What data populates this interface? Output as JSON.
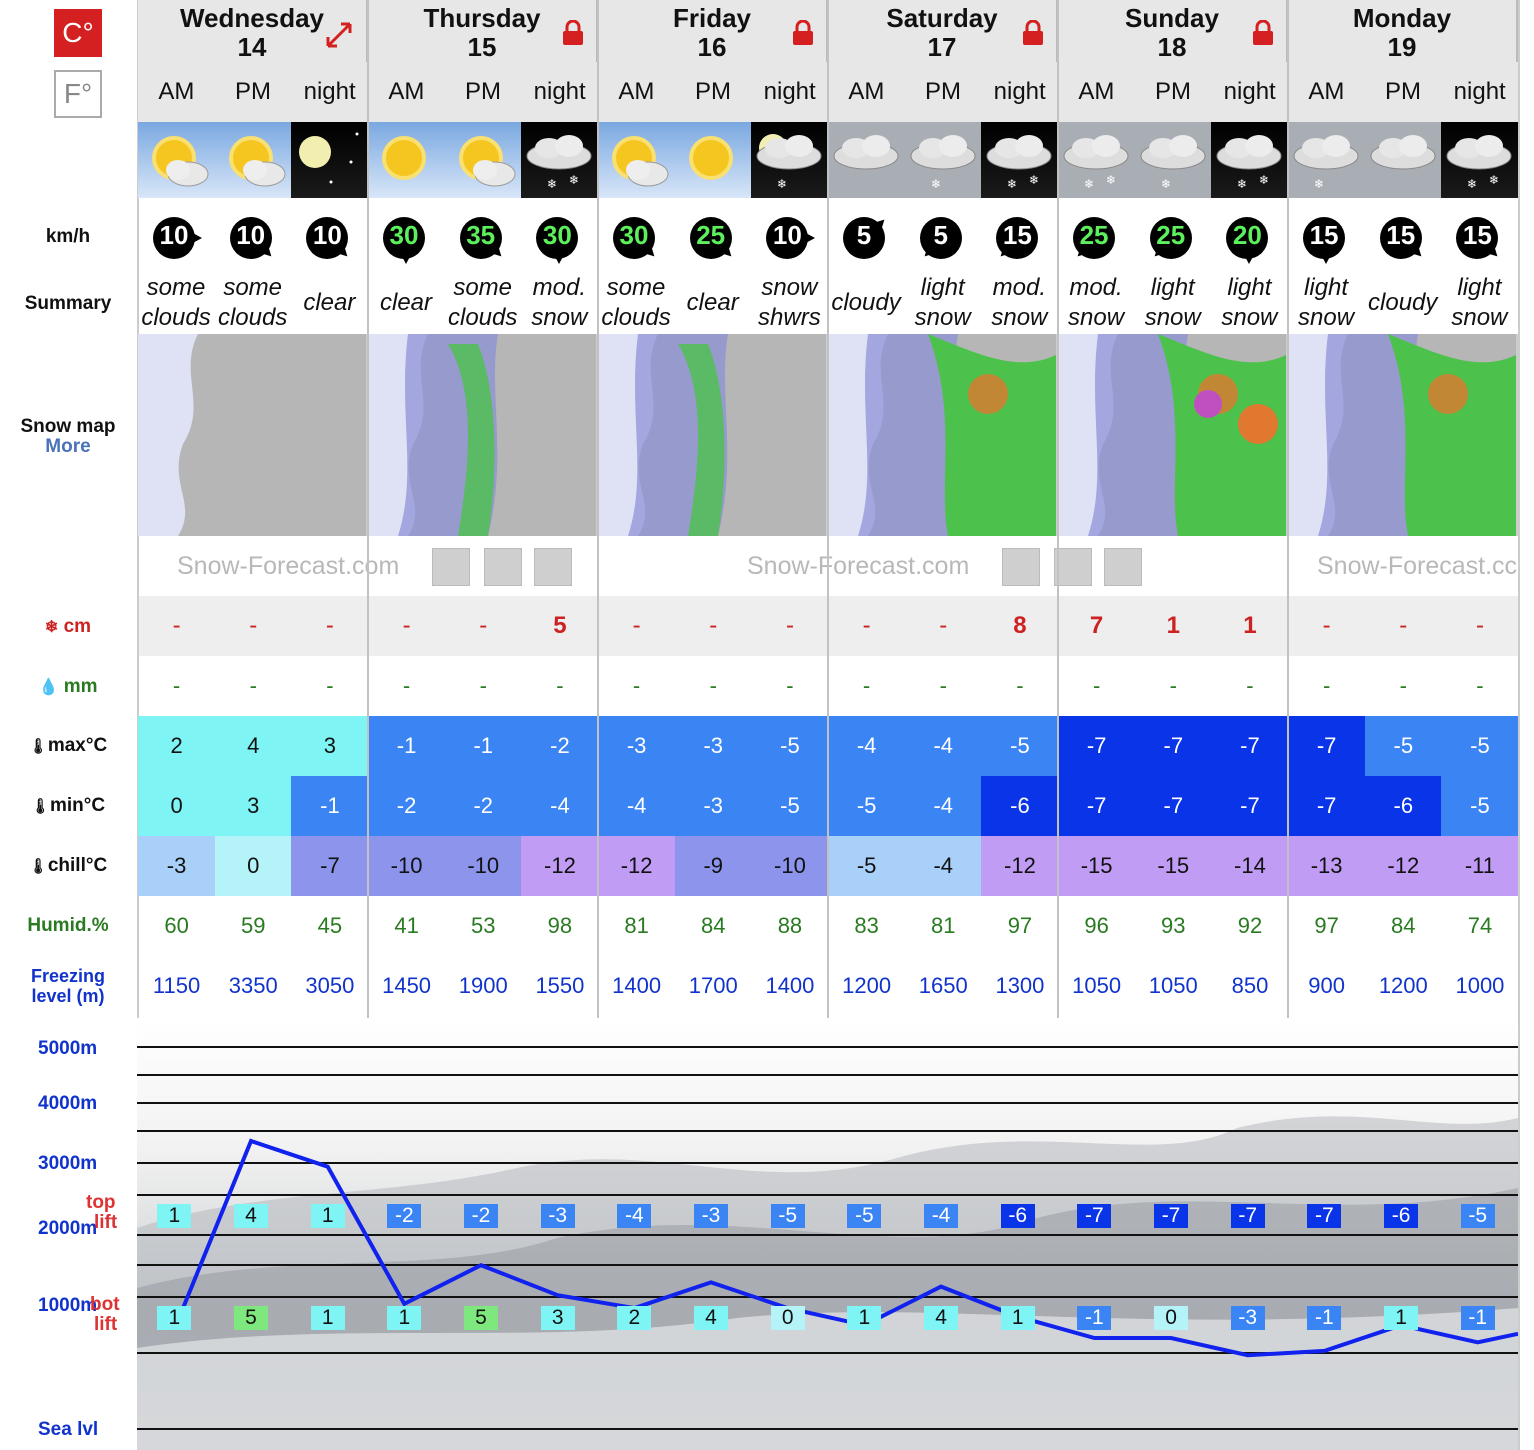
{
  "units": {
    "celsius": "C°",
    "fahrenheit": "F°",
    "active": "C"
  },
  "days": [
    {
      "name": "Wednesday",
      "date": "14",
      "icon": "expand-icon"
    },
    {
      "name": "Thursday",
      "date": "15",
      "icon": "lock-icon"
    },
    {
      "name": "Friday",
      "date": "16",
      "icon": "lock-icon"
    },
    {
      "name": "Saturday",
      "date": "17",
      "icon": "lock-icon"
    },
    {
      "name": "Sunday",
      "date": "18",
      "icon": "lock-icon"
    },
    {
      "name": "Monday",
      "date": "19",
      "icon": "none"
    }
  ],
  "labels": {
    "wind": "km/h",
    "summary": "Summary",
    "snow_map": "Snow map",
    "more": "More",
    "snow": "cm",
    "rain": "mm",
    "max": "max°C",
    "min": "min°C",
    "chill": "chill°C",
    "humid": "Humid.%",
    "freezing_1": "Freezing",
    "freezing_2": "level (m)",
    "alt_5000": "5000m",
    "alt_4000": "4000m",
    "alt_3000": "3000m",
    "alt_2000": "2000m",
    "alt_1000": "1000m",
    "sea": "Sea lvl",
    "top": "top",
    "lift": "lift",
    "bot": "bot",
    "watermark": "Snow-Forecast.com",
    "watermark_cut": "Snow-Forecast.cc"
  },
  "periods": [
    {
      "label": "AM",
      "weather": "some-clouds-day",
      "wind": "10",
      "wind_dir": 0,
      "wind_color": "white",
      "summary": [
        "some",
        "clouds"
      ],
      "snow": "-",
      "rain": "-",
      "max": "2",
      "max_bg": "#7ef4f4",
      "min": "0",
      "min_bg": "#7ef4f4",
      "chill": "-3",
      "chill_bg": "#a8d0f8",
      "humid": "60",
      "freezing": "1150",
      "top": "1",
      "top_bg": "#7ef4f4",
      "bot": "1",
      "bot_bg": "#7ef4f4"
    },
    {
      "label": "PM",
      "weather": "some-clouds-day",
      "wind": "10",
      "wind_dir": 45,
      "wind_color": "white",
      "summary": [
        "some",
        "clouds"
      ],
      "snow": "-",
      "rain": "-",
      "max": "4",
      "max_bg": "#7ef4f4",
      "min": "3",
      "min_bg": "#7ef4f4",
      "chill": "0",
      "chill_bg": "#b4f4f8",
      "humid": "59",
      "freezing": "3350",
      "top": "4",
      "top_bg": "#7ef4f4",
      "bot": "5",
      "bot_bg": "#7ee87e"
    },
    {
      "label": "night",
      "weather": "clear-night",
      "wind": "10",
      "wind_dir": 45,
      "wind_color": "white",
      "summary": [
        "clear"
      ],
      "snow": "-",
      "rain": "-",
      "max": "3",
      "max_bg": "#7ef4f4",
      "min": "-1",
      "min_bg": "#3b84f4",
      "chill": "-7",
      "chill_bg": "#8c94ec",
      "humid": "45",
      "freezing": "3050",
      "top": "1",
      "top_bg": "#7ef4f4",
      "bot": "1",
      "bot_bg": "#7ef4f4"
    },
    {
      "label": "AM",
      "weather": "clear-day",
      "wind": "30",
      "wind_dir": 90,
      "wind_color": "green",
      "summary": [
        "clear"
      ],
      "snow": "-",
      "rain": "-",
      "max": "-1",
      "max_bg": "#3b84f4",
      "min": "-2",
      "min_bg": "#3b84f4",
      "chill": "-10",
      "chill_bg": "#8c94ec",
      "humid": "41",
      "freezing": "1450",
      "top": "-2",
      "top_bg": "#3b84f4",
      "bot": "1",
      "bot_bg": "#7ef4f4"
    },
    {
      "label": "PM",
      "weather": "some-clouds-day",
      "wind": "35",
      "wind_dir": 45,
      "wind_color": "green",
      "summary": [
        "some",
        "clouds"
      ],
      "snow": "-",
      "rain": "-",
      "max": "-1",
      "max_bg": "#3b84f4",
      "min": "-2",
      "min_bg": "#3b84f4",
      "chill": "-10",
      "chill_bg": "#8c94ec",
      "humid": "53",
      "freezing": "1900",
      "top": "-2",
      "top_bg": "#3b84f4",
      "bot": "5",
      "bot_bg": "#7ee87e"
    },
    {
      "label": "night",
      "weather": "snow-night",
      "wind": "30",
      "wind_dir": 90,
      "wind_color": "green",
      "summary": [
        "mod.",
        "snow"
      ],
      "snow": "5",
      "rain": "-",
      "max": "-2",
      "max_bg": "#3b84f4",
      "min": "-4",
      "min_bg": "#3b84f4",
      "chill": "-12",
      "chill_bg": "#c09cf4",
      "humid": "98",
      "freezing": "1550",
      "top": "-3",
      "top_bg": "#3b84f4",
      "bot": "3",
      "bot_bg": "#7ef4f4"
    },
    {
      "label": "AM",
      "weather": "some-clouds-day",
      "wind": "30",
      "wind_dir": 45,
      "wind_color": "green",
      "summary": [
        "some",
        "clouds"
      ],
      "snow": "-",
      "rain": "-",
      "max": "-3",
      "max_bg": "#3b84f4",
      "min": "-4",
      "min_bg": "#3b84f4",
      "chill": "-12",
      "chill_bg": "#c09cf4",
      "humid": "81",
      "freezing": "1400",
      "top": "-4",
      "top_bg": "#3b84f4",
      "bot": "2",
      "bot_bg": "#7ef4f4"
    },
    {
      "label": "PM",
      "weather": "clear-day",
      "wind": "25",
      "wind_dir": 45,
      "wind_color": "green",
      "summary": [
        "clear"
      ],
      "snow": "-",
      "rain": "-",
      "max": "-3",
      "max_bg": "#3b84f4",
      "min": "-3",
      "min_bg": "#3b84f4",
      "chill": "-9",
      "chill_bg": "#8c94ec",
      "humid": "84",
      "freezing": "1700",
      "top": "-3",
      "top_bg": "#3b84f4",
      "bot": "4",
      "bot_bg": "#7ef4f4"
    },
    {
      "label": "night",
      "weather": "snow-showers-night",
      "wind": "10",
      "wind_dir": 0,
      "wind_color": "white",
      "summary": [
        "snow",
        "shwrs"
      ],
      "snow": "-",
      "rain": "-",
      "max": "-5",
      "max_bg": "#3b84f4",
      "min": "-5",
      "min_bg": "#3b84f4",
      "chill": "-10",
      "chill_bg": "#8c94ec",
      "humid": "88",
      "freezing": "1400",
      "top": "-5",
      "top_bg": "#3b84f4",
      "bot": "0",
      "bot_bg": "#b4f4f8"
    },
    {
      "label": "AM",
      "weather": "cloudy",
      "wind": "5",
      "wind_dir": -45,
      "wind_color": "white",
      "summary": [
        "cloudy"
      ],
      "snow": "-",
      "rain": "-",
      "max": "-4",
      "max_bg": "#3b84f4",
      "min": "-5",
      "min_bg": "#3b84f4",
      "chill": "-5",
      "chill_bg": "#a8d0f8",
      "humid": "83",
      "freezing": "1200",
      "top": "-5",
      "top_bg": "#3b84f4",
      "bot": "1",
      "bot_bg": "#7ef4f4"
    },
    {
      "label": "PM",
      "weather": "light-snow",
      "wind": "5",
      "wind_dir": 135,
      "wind_color": "white",
      "summary": [
        "light",
        "snow"
      ],
      "snow": "-",
      "rain": "-",
      "max": "-4",
      "max_bg": "#3b84f4",
      "min": "-4",
      "min_bg": "#3b84f4",
      "chill": "-4",
      "chill_bg": "#a8d0f8",
      "humid": "81",
      "freezing": "1650",
      "top": "-4",
      "top_bg": "#3b84f4",
      "bot": "4",
      "bot_bg": "#7ef4f4"
    },
    {
      "label": "night",
      "weather": "snow-night",
      "wind": "15",
      "wind_dir": 135,
      "wind_color": "white",
      "summary": [
        "mod.",
        "snow"
      ],
      "snow": "8",
      "rain": "-",
      "max": "-5",
      "max_bg": "#3b84f4",
      "min": "-6",
      "min_bg": "#0a34e8",
      "chill": "-12",
      "chill_bg": "#c09cf4",
      "humid": "97",
      "freezing": "1300",
      "top": "-6",
      "top_bg": "#0a34e8",
      "bot": "1",
      "bot_bg": "#7ef4f4"
    },
    {
      "label": "AM",
      "weather": "snow-day",
      "wind": "25",
      "wind_dir": 135,
      "wind_color": "green",
      "summary": [
        "mod.",
        "snow"
      ],
      "snow": "7",
      "rain": "-",
      "max": "-7",
      "max_bg": "#0a34e8",
      "min": "-7",
      "min_bg": "#0a34e8",
      "chill": "-15",
      "chill_bg": "#c09cf4",
      "humid": "96",
      "freezing": "1050",
      "top": "-7",
      "top_bg": "#0a34e8",
      "bot": "-1",
      "bot_bg": "#3b84f4"
    },
    {
      "label": "PM",
      "weather": "light-snow",
      "wind": "25",
      "wind_dir": 135,
      "wind_color": "green",
      "summary": [
        "light",
        "snow"
      ],
      "snow": "1",
      "rain": "-",
      "max": "-7",
      "max_bg": "#0a34e8",
      "min": "-7",
      "min_bg": "#0a34e8",
      "chill": "-15",
      "chill_bg": "#c09cf4",
      "humid": "93",
      "freezing": "1050",
      "top": "-7",
      "top_bg": "#0a34e8",
      "bot": "0",
      "bot_bg": "#b4f4f8"
    },
    {
      "label": "night",
      "weather": "snow-night",
      "wind": "20",
      "wind_dir": 90,
      "wind_color": "green",
      "summary": [
        "light",
        "snow"
      ],
      "snow": "1",
      "rain": "-",
      "max": "-7",
      "max_bg": "#0a34e8",
      "min": "-7",
      "min_bg": "#0a34e8",
      "chill": "-14",
      "chill_bg": "#c09cf4",
      "humid": "92",
      "freezing": "850",
      "top": "-7",
      "top_bg": "#0a34e8",
      "bot": "-3",
      "bot_bg": "#3b84f4"
    },
    {
      "label": "AM",
      "weather": "light-snow",
      "wind": "15",
      "wind_dir": 90,
      "wind_color": "white",
      "summary": [
        "light",
        "snow"
      ],
      "snow": "-",
      "rain": "-",
      "max": "-7",
      "max_bg": "#0a34e8",
      "min": "-7",
      "min_bg": "#0a34e8",
      "chill": "-13",
      "chill_bg": "#c09cf4",
      "humid": "97",
      "freezing": "900",
      "top": "-7",
      "top_bg": "#0a34e8",
      "bot": "-1",
      "bot_bg": "#3b84f4"
    },
    {
      "label": "PM",
      "weather": "cloudy",
      "wind": "15",
      "wind_dir": 45,
      "wind_color": "white",
      "summary": [
        "cloudy"
      ],
      "snow": "-",
      "rain": "-",
      "max": "-5",
      "max_bg": "#3b84f4",
      "min": "-6",
      "min_bg": "#0a34e8",
      "chill": "-12",
      "chill_bg": "#c09cf4",
      "humid": "84",
      "freezing": "1200",
      "top": "-6",
      "top_bg": "#0a34e8",
      "bot": "1",
      "bot_bg": "#7ef4f4"
    },
    {
      "label": "night",
      "weather": "snow-night",
      "wind": "15",
      "wind_dir": 45,
      "wind_color": "white",
      "summary": [
        "light",
        "snow"
      ],
      "snow": "-",
      "rain": "-",
      "max": "-5",
      "max_bg": "#3b84f4",
      "min": "-5",
      "min_bg": "#3b84f4",
      "chill": "-11",
      "chill_bg": "#c09cf4",
      "humid": "74",
      "freezing": "1000",
      "top": "-5",
      "top_bg": "#3b84f4",
      "bot": "-1",
      "bot_bg": "#3b84f4"
    }
  ],
  "maps": [
    "sparse",
    "light",
    "light",
    "moderate",
    "heavy",
    "moderate"
  ],
  "colors": {
    "snow_text": "#cc2222",
    "humid_text": "#2a7a22",
    "freezing_text": "#1133cc",
    "altitude_text": "#1133cc",
    "lift_text": "#dd3333",
    "line": "#1122ee"
  }
}
